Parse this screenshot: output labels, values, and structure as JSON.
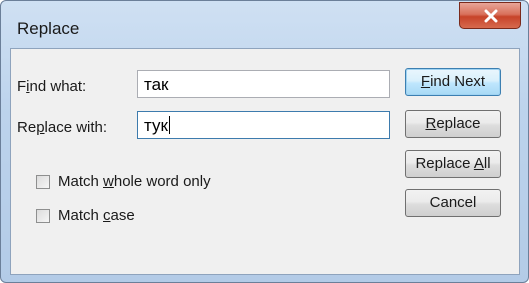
{
  "window": {
    "title": "Replace"
  },
  "fields": {
    "find_label_pre": "F",
    "find_label_u": "i",
    "find_label_post": "nd what:",
    "find_value": "так",
    "replace_label_pre": "Re",
    "replace_label_u": "p",
    "replace_label_post": "lace with:",
    "replace_value": "тук"
  },
  "options": {
    "whole_word_pre": "Match ",
    "whole_word_u": "w",
    "whole_word_post": "hole word only",
    "whole_word_checked": false,
    "match_case_pre": "Match ",
    "match_case_u": "c",
    "match_case_post": "ase",
    "match_case_checked": false
  },
  "buttons": {
    "find_next_u": "F",
    "find_next_post": "ind Next",
    "replace_u": "R",
    "replace_post": "eplace",
    "replace_all_pre": "Replace ",
    "replace_all_u": "A",
    "replace_all_post": "ll",
    "cancel": "Cancel"
  }
}
